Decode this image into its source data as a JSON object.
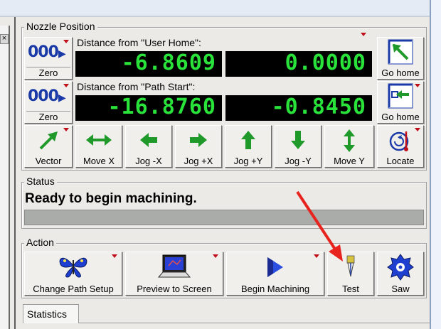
{
  "left_panel": {
    "close_glyph": "×"
  },
  "nozzle": {
    "group_title": "Nozzle Position",
    "user_home_label": "Distance from \"User Home\":",
    "path_start_label": "Distance from \"Path Start\":",
    "user_home_x": "-6.8609",
    "user_home_y": "0.0000",
    "path_start_x": "-16.8760",
    "path_start_y": "-0.8450",
    "zero_icon_text": "000",
    "zero_label": "Zero",
    "go_home_label": "Go home",
    "buttons": [
      {
        "label": "Vector",
        "icon": "vector-arrow-icon"
      },
      {
        "label": "Move X",
        "icon": "move-x-icon"
      },
      {
        "label": "Jog -X",
        "icon": "jog-left-arrow-icon"
      },
      {
        "label": "Jog +X",
        "icon": "jog-right-arrow-icon"
      },
      {
        "label": "Jog +Y",
        "icon": "jog-up-arrow-icon"
      },
      {
        "label": "Jog -Y",
        "icon": "jog-down-arrow-icon"
      },
      {
        "label": "Move Y",
        "icon": "move-y-icon"
      },
      {
        "label": "Locate",
        "icon": "locate-icon"
      }
    ]
  },
  "status": {
    "group_title": "Status",
    "message": "Ready to begin machining."
  },
  "action": {
    "group_title": "Action",
    "buttons": [
      {
        "label": "Change Path Setup",
        "icon": "butterfly-icon"
      },
      {
        "label": "Preview to Screen",
        "icon": "laptop-preview-icon"
      },
      {
        "label": "Begin Machining",
        "icon": "play-triangle-icon"
      },
      {
        "label": "Test",
        "icon": "test-tool-icon"
      },
      {
        "label": "Saw",
        "icon": "saw-blade-icon"
      }
    ]
  },
  "tabs": [
    {
      "label": "Statistics"
    }
  ],
  "colors": {
    "dro_text": "#29e33a",
    "dro_background": "#000000",
    "dropdown_marker": "#c0101c",
    "annotation_arrow": "#e8231e",
    "icon_blue": "#1a3aa8",
    "icon_green": "#1f9a2a"
  }
}
